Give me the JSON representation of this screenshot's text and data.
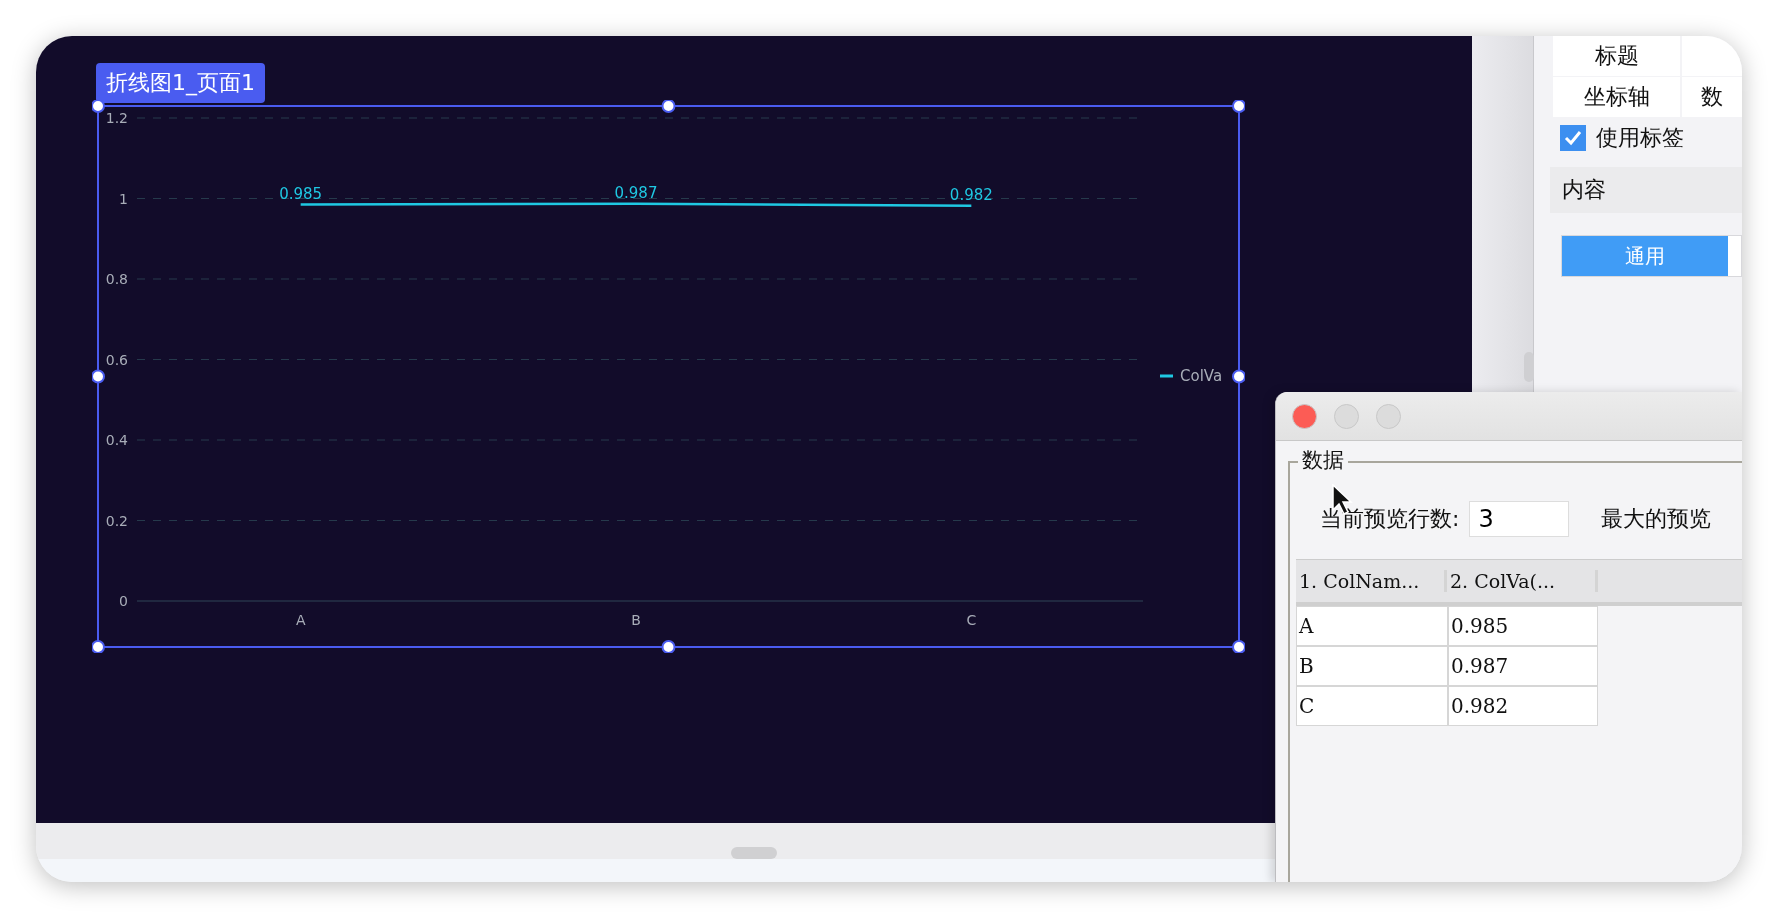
{
  "canvas": {
    "component_label": "折线图1_页面1",
    "chart_data": {
      "type": "line",
      "categories": [
        "A",
        "B",
        "C"
      ],
      "series": [
        {
          "name": "ColVa",
          "color": "#1fc8e3",
          "values": [
            0.985,
            0.987,
            0.982
          ]
        }
      ],
      "grid": true,
      "ylim": [
        0,
        1.2
      ],
      "yticks": [
        0,
        0.2,
        0.4,
        0.6,
        0.8,
        1,
        1.2
      ],
      "data_labels": true
    }
  },
  "properties_panel": {
    "tab_rows": [
      {
        "cells": [
          {
            "label": "标题"
          }
        ]
      },
      {
        "cells": [
          {
            "label": "坐标轴"
          },
          {
            "label": "数"
          }
        ]
      }
    ],
    "use_label": {
      "label": "使用标签",
      "checked": true
    },
    "section": "内容",
    "segments": [
      {
        "label": "通用",
        "selected": true
      }
    ]
  },
  "dialog": {
    "group_title": "数据",
    "preview_rows": {
      "label": "当前预览行数:",
      "value": "3"
    },
    "max_label": "最大的预览",
    "table": {
      "columns": [
        "1. ColNam...",
        "2. ColVa(..."
      ],
      "rows": [
        [
          "A",
          "0.985"
        ],
        [
          "B",
          "0.987"
        ],
        [
          "C",
          "0.982"
        ]
      ]
    }
  }
}
